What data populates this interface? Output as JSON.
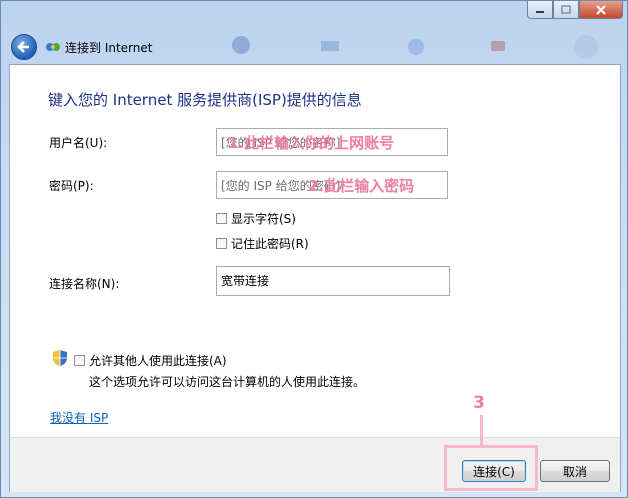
{
  "window": {
    "nav_title": "连接到 Internet",
    "controls": {
      "minimize": "minimize",
      "maximize": "maximize",
      "close": "close"
    }
  },
  "main": {
    "heading": "键入您的 Internet 服务提供商(ISP)提供的信息",
    "username": {
      "label": "用户名(U):",
      "placeholder": "[您的 ISP 给您的名称]",
      "annotation": "1.此栏输入你的上网账号"
    },
    "password": {
      "label": "密码(P):",
      "placeholder": "[您的 ISP 给您的密码]",
      "annotation": "2.此栏输入密码"
    },
    "show_chars": {
      "label": "显示字符(S)",
      "checked": false
    },
    "remember_password": {
      "label": "记住此密码(R)",
      "checked": false
    },
    "connection_name": {
      "label": "连接名称(N):",
      "value": "宽带连接"
    },
    "allow_others": {
      "label": "允许其他人使用此连接(A)",
      "description": "这个选项允许可以访问这台计算机的人使用此连接。",
      "checked": false
    },
    "no_isp_link": "我没有 ISP"
  },
  "footer": {
    "connect_label": "连接(C)",
    "cancel_label": "取消",
    "step_marker": "3"
  },
  "colors": {
    "heading": "#1e3287",
    "annotation": "#f07fa5",
    "link": "#0b63b6"
  }
}
